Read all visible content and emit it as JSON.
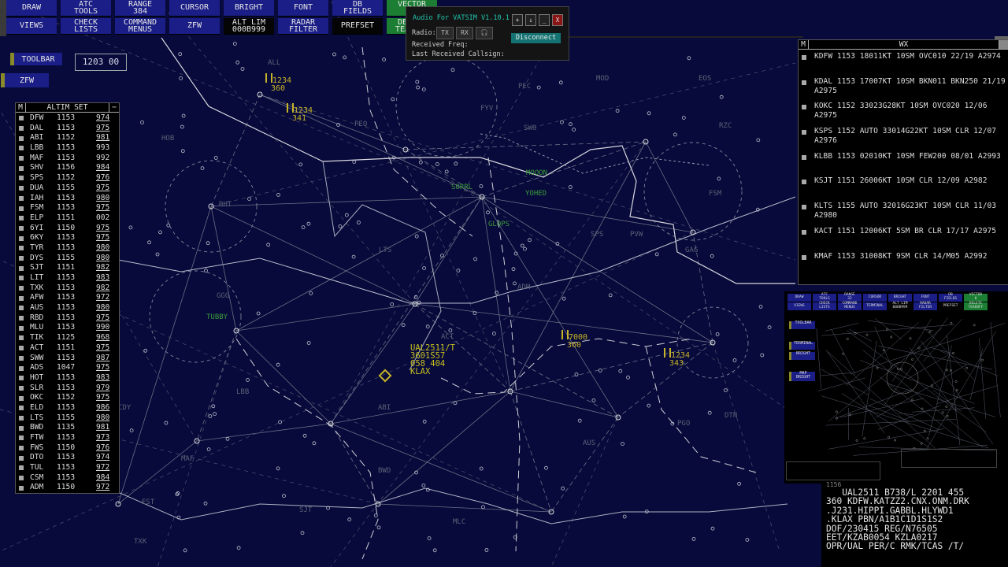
{
  "dcb": {
    "buttons": [
      {
        "top": "DRAW",
        "bottom": "VIEWS"
      },
      {
        "top": "ATC\nTOOLS",
        "bottom": "CHECK\nLISTS"
      },
      {
        "top": "RANGE\n384",
        "bottom": "COMMAND\nMENUS"
      },
      {
        "top": "CURSOR",
        "bottom": "ZFW"
      },
      {
        "top": "BRIGHT",
        "bottom": "ALT LIM\n000B999"
      },
      {
        "top": "FONT",
        "bottom": "RADAR\nFILTER"
      },
      {
        "top": "DB\nFIELDS",
        "bottom": "PREFSET"
      },
      {
        "top": "VECTOR\n0",
        "bottom": "DELETE\nTEAROFF"
      }
    ]
  },
  "toolbar_label": "TOOLBAR",
  "zfw_label": "ZFW",
  "clock": "1203 00",
  "audio": {
    "title": "Audio For VATSIM V1.10.1",
    "radio_label": "Radio:",
    "tx": "TX",
    "rx": "RX",
    "received_freq": "Received Freq:",
    "last_callsign": "Last Received Callsign:",
    "disconnect": "Disconnect",
    "win_btns": [
      "+",
      "↓",
      "_",
      "X"
    ]
  },
  "altim": {
    "m": "M",
    "title": "ALTIM SET",
    "minus": "−",
    "rows": [
      [
        "DFW",
        "1153",
        "974",
        true
      ],
      [
        "DAL",
        "1153",
        "975",
        true
      ],
      [
        "ABI",
        "1152",
        "981",
        true
      ],
      [
        "LBB",
        "1153",
        "993",
        false
      ],
      [
        "MAF",
        "1153",
        "992",
        false
      ],
      [
        "SHV",
        "1156",
        "984",
        true
      ],
      [
        "SPS",
        "1152",
        "976",
        true
      ],
      [
        "DUA",
        "1155",
        "975",
        true
      ],
      [
        "IAH",
        "1153",
        "980",
        true
      ],
      [
        "FSM",
        "1153",
        "975",
        true
      ],
      [
        "ELP",
        "1151",
        "002",
        false
      ],
      [
        "6YI",
        "1150",
        "975",
        true
      ],
      [
        "6KY",
        "1153",
        "975",
        true
      ],
      [
        "TYR",
        "1153",
        "980",
        true
      ],
      [
        "DYS",
        "1155",
        "980",
        true
      ],
      [
        "SJT",
        "1151",
        "982",
        true
      ],
      [
        "LIT",
        "1153",
        "983",
        true
      ],
      [
        "TXK",
        "1153",
        "982",
        true
      ],
      [
        "AFW",
        "1153",
        "972",
        true
      ],
      [
        "AUS",
        "1153",
        "980",
        true
      ],
      [
        "RBD",
        "1153",
        "975",
        true
      ],
      [
        "MLU",
        "1153",
        "990",
        true
      ],
      [
        "TIK",
        "1125",
        "968",
        true
      ],
      [
        "ACT",
        "1151",
        "975",
        true
      ],
      [
        "SWW",
        "1153",
        "987",
        true
      ],
      [
        "ADS",
        "1047",
        "975",
        true
      ],
      [
        "HOT",
        "1153",
        "983",
        true
      ],
      [
        "SLR",
        "1153",
        "979",
        true
      ],
      [
        "OKC",
        "1152",
        "975",
        true
      ],
      [
        "ELD",
        "1153",
        "986",
        true
      ],
      [
        "LTS",
        "1155",
        "980",
        true
      ],
      [
        "BWD",
        "1135",
        "981",
        true
      ],
      [
        "FTW",
        "1153",
        "973",
        true
      ],
      [
        "FWS",
        "1150",
        "976",
        true
      ],
      [
        "DTO",
        "1153",
        "974",
        true
      ],
      [
        "TUL",
        "1153",
        "972",
        true
      ],
      [
        "CSM",
        "1153",
        "984",
        true
      ],
      [
        "ADM",
        "1150",
        "972",
        true
      ]
    ]
  },
  "wx": {
    "m": "M",
    "title": "WX",
    "items": [
      "KDFW 1153 18011KT 10SM OVC010 22/19 A2974",
      "KDAL 1153 17007KT 10SM BKN011 BKN250 21/19 A2975",
      "KOKC 1152 33023G28KT 10SM OVC020 12/06 A2975",
      "KSPS 1152 AUTO 33014G22KT 10SM CLR 12/07 A2976",
      "KLBB 1153 02010KT 10SM FEW200 08/01 A2993",
      "KSJT 1151 26006KT 10SM CLR 12/09 A2982",
      "KLTS 1155 AUTO 32016G23KT 10SM CLR 11/03 A2980",
      "KACT 1151 12006KT 5SM BR CLR 17/17 A2975",
      "KMAF 1153 31008KT 9SM CLR 14/M05 A2992"
    ]
  },
  "targets": [
    {
      "l1": "1234",
      "l2": "360"
    },
    {
      "l1": "1234",
      "l2": "341"
    },
    {
      "l1": "7000",
      "l2": "360"
    },
    {
      "l1": "1234",
      "l2": "343"
    }
  ],
  "datablock": {
    "l1": "UAL2511/T",
    "l2": "3601S57",
    "l3": "058 404",
    "l4": "KLAX"
  },
  "fixes": [
    "SORRL",
    "MOOON",
    "YOHED",
    "GLOPS",
    "TUBBY",
    "ALL",
    "PEC",
    "EOS",
    "MOD",
    "RZC",
    "SWO",
    "FSM",
    "LTS",
    "ADM",
    "SPS",
    "LBB",
    "MAF",
    "ABI",
    "BWD",
    "ACT",
    "DTN",
    "SJT",
    "AUS",
    "CDY",
    "HOB",
    "DHT",
    "PVW",
    "GAG",
    "MLC",
    "PGO",
    "TXK",
    "GGG",
    "EST",
    "FYV",
    "PEQ"
  ],
  "flightplan": [
    "1156",
    "   UAL2511 B738/L 2201 455",
    "360 KDFW.KATZZ2.CNX.ONM.DRK",
    ".J231.HIPPI.GABBL.HLYWD1",
    ".KLAX PBN/A1B1C1D1S1S2",
    "DOF/230415 REG/N76505",
    "EET/KZAB0054 KZLA0217",
    "OPR/UAL PER/C RMK/TCAS /T/"
  ],
  "mini": {
    "buttons": [
      {
        "top": "DRAW",
        "bottom": "VIEWS"
      },
      {
        "top": "ATC\nTOOLS",
        "bottom": "CHECK\nLISTS"
      },
      {
        "top": "RANGE\n32",
        "bottom": "COMMAND\nMENUS"
      },
      {
        "top": "CURSOR",
        "bottom": "TERMINAL"
      },
      {
        "top": "BRIGHT",
        "bottom": "ALT LIM\n000B999"
      },
      {
        "top": "FONT",
        "bottom": "RADAR\nFILTER"
      },
      {
        "top": "DB\nFIELDS",
        "bottom": "PREFSET"
      },
      {
        "top": "VECTOR\n0",
        "bottom": "DELETE\nTEAROFF"
      }
    ],
    "side": [
      "TOOLBAR",
      "TERMINAL",
      "BRIGHT",
      "MAP\nBRIGHT"
    ]
  },
  "colors": {
    "scope_bg": "#070a3a",
    "dcb_blue": "#1a1e86",
    "dcb_green": "#1b7e33",
    "target": "#c8b428",
    "fix_green": "#3c9a3c"
  }
}
